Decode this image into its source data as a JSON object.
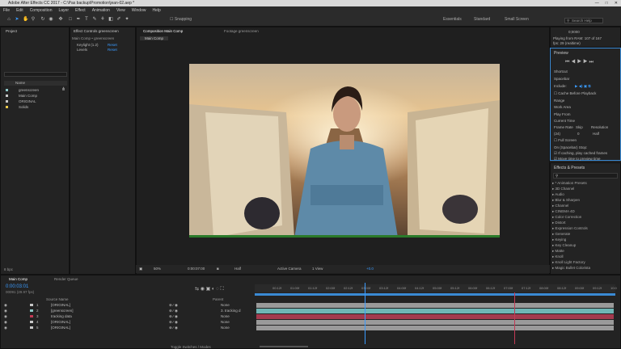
{
  "window": {
    "title": "Adobe After Effects CC 2017 - C:\\Pas backup\\Promotion\\jean-02.aep *"
  },
  "menu": [
    "File",
    "Edit",
    "Composition",
    "Layer",
    "Effect",
    "Animation",
    "View",
    "Window",
    "Help"
  ],
  "toolbar": {
    "snapping": "Snapping",
    "workspaces": [
      "Essentials",
      "Standard",
      "Small Screen"
    ],
    "search_placeholder": "Search Help"
  },
  "project": {
    "tab": "Project",
    "effect_controls_tab": "Effect Controls greenscreen",
    "comp_path": "Main Comp • greenscreen",
    "effects": [
      {
        "name": "Keylight (1.2)",
        "reset": "Reset"
      },
      {
        "name": "Levels",
        "reset": "Reset"
      }
    ],
    "search_placeholder": "",
    "col_name": "Name",
    "items": [
      "greenscreen",
      "Main Comp",
      "ORIGINAL",
      "Solids"
    ],
    "bpc": "8 bpc"
  },
  "composition": {
    "tab": "Composition Main Comp",
    "footage_tab": "Footage greenscreen",
    "subtab": "Main Comp",
    "zoom": "50%",
    "timecode": "0:00:07:00",
    "resolution": "Half",
    "camera": "Active Camera",
    "view": "1 View",
    "exposure": "+0.0"
  },
  "info": {
    "timecode": "0;0000",
    "line1": "Playing from RAM: 107 of 167",
    "line2": "fps: 29 (realtime)"
  },
  "preview": {
    "title": "Preview",
    "shortcut_label": "Shortcut",
    "shortcut_value": "Spacebar",
    "include_label": "Include:",
    "cache_label": "Cache Before Playback",
    "range_label": "Range",
    "range_value": "Work Area",
    "play_from_label": "Play From",
    "play_from_value": "Current Time",
    "frame_rate_label": "Frame Rate",
    "skip_label": "Skip",
    "resolution_label": "Resolution",
    "frame_rate_value": "(24)",
    "skip_value": "0",
    "resolution_value": "Half",
    "full_screen": "Full Screen",
    "on_stop": "On (Spacebar) Stop:",
    "if_caching": "If caching, play cached frames",
    "move_time": "Move time to preview time"
  },
  "effects_presets": {
    "title": "Effects & Presets",
    "search_placeholder": "",
    "items": [
      "* Animation Presets",
      "3D Channel",
      "Audio",
      "Blur & Sharpen",
      "Channel",
      "CINEMA 4D",
      "Color Correction",
      "Distort",
      "Expression Controls",
      "Generate",
      "Keying",
      "Key Cleanup",
      "Matte",
      "Knoll",
      "Knoll Light Factory",
      "Magic Bullet Colorista",
      "Matte",
      "Noise & Grain"
    ]
  },
  "timeline": {
    "tab": "Main Comp",
    "render_tab": "Render Queue",
    "timecode": "0:00:03:01",
    "fps_note": "00091 (29.97 fps)",
    "col_source": "Source Name",
    "col_parent": "Parent",
    "layers": [
      {
        "num": "1",
        "name": "[ORIGINAL]",
        "parent": "None",
        "color": "#c7c7c7"
      },
      {
        "num": "2",
        "name": "[greenscreen]",
        "parent": "3. tracking d",
        "color": "#8fc9c9"
      },
      {
        "num": "3",
        "name": "tracking data",
        "parent": "None",
        "color": "#c23a55"
      },
      {
        "num": "4",
        "name": "[ORIGINAL]",
        "parent": "None",
        "color": "#c7c7c7"
      },
      {
        "num": "5",
        "name": "[ORIGINAL]",
        "parent": "None",
        "color": "#c7c7c7"
      }
    ],
    "ruler": [
      "00:12f",
      "01:00f",
      "01:12f",
      "02:00f",
      "02:12f",
      "03:00f",
      "03:12f",
      "04:00f",
      "04:12f",
      "05:00f",
      "05:12f",
      "06:00f",
      "06:12f",
      "07:00f",
      "07:12f",
      "08:00f",
      "08:12f",
      "09:00f",
      "09:12f",
      "10:0"
    ],
    "toggle": "Toggle Switches / Modes"
  },
  "colors": {
    "accent": "#3a9bff",
    "highlight": "#e8a23b",
    "tracking": "#c23a55",
    "teal": "#6fb5b5"
  }
}
